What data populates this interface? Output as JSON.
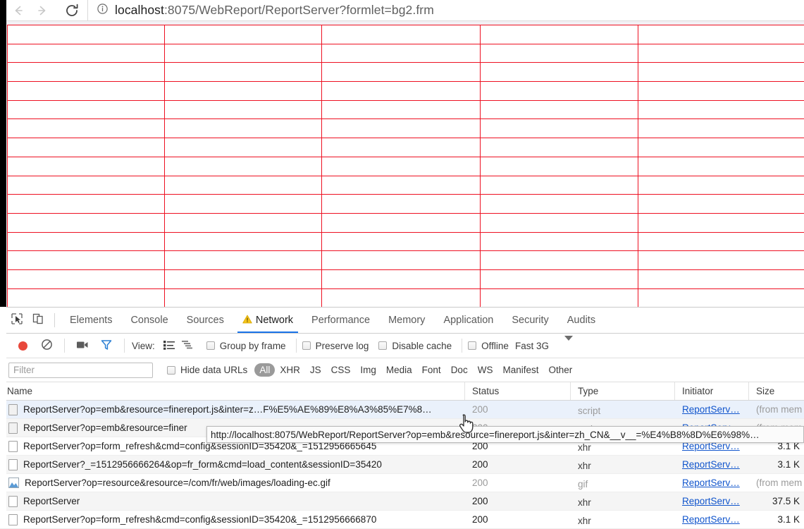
{
  "browser": {
    "back_icon": "arrow-left-icon",
    "forward_icon": "arrow-right-icon",
    "reload_icon": "reload-icon",
    "info_icon": "page-info-icon",
    "url_host": "localhost",
    "url_rest": ":8075/WebReport/ReportServer?formlet=bg2.frm",
    "url_full": "localhost:8075/WebReport/ReportServer?formlet=bg2.frm"
  },
  "report": {
    "grid_border_color": "#ee1122",
    "columns": 6,
    "rows": 16,
    "cells": []
  },
  "devtools": {
    "tools": {
      "inspect_icon": "inspect-element-icon",
      "device_icon": "device-toolbar-icon"
    },
    "tabs": [
      {
        "label": "Elements",
        "active": false,
        "warn": false
      },
      {
        "label": "Console",
        "active": false,
        "warn": false
      },
      {
        "label": "Sources",
        "active": false,
        "warn": false
      },
      {
        "label": "Network",
        "active": true,
        "warn": true
      },
      {
        "label": "Performance",
        "active": false,
        "warn": false
      },
      {
        "label": "Memory",
        "active": false,
        "warn": false
      },
      {
        "label": "Application",
        "active": false,
        "warn": false
      },
      {
        "label": "Security",
        "active": false,
        "warn": false
      },
      {
        "label": "Audits",
        "active": false,
        "warn": false
      }
    ],
    "record_bar": {
      "record_icon": "record-stop-icon",
      "clear_icon": "clear-network-log-icon",
      "capture_screenshots_icon": "camera-icon",
      "filter_icon": "funnel-filter-icon",
      "view_label": "View:",
      "view_list_icon": "list-view-icon",
      "view_waterfall_icon": "waterfall-view-icon",
      "group_by_frame": {
        "label": "Group by frame",
        "checked": false
      },
      "preserve_log": {
        "label": "Preserve log",
        "checked": false
      },
      "disable_cache": {
        "label": "Disable cache",
        "checked": false
      },
      "offline": {
        "label": "Offline",
        "checked": false
      },
      "throttle": {
        "label": "Fast 3G",
        "caret_icon": "chevron-down-icon"
      }
    },
    "filter_bar": {
      "filter_placeholder": "Filter",
      "filter_value": "",
      "hide_data_urls": {
        "label": "Hide data URLs",
        "checked": false
      },
      "types": [
        {
          "label": "All",
          "selected": true
        },
        {
          "label": "XHR",
          "selected": false
        },
        {
          "label": "JS",
          "selected": false
        },
        {
          "label": "CSS",
          "selected": false
        },
        {
          "label": "Img",
          "selected": false
        },
        {
          "label": "Media",
          "selected": false
        },
        {
          "label": "Font",
          "selected": false
        },
        {
          "label": "Doc",
          "selected": false
        },
        {
          "label": "WS",
          "selected": false
        },
        {
          "label": "Manifest",
          "selected": false
        },
        {
          "label": "Other",
          "selected": false
        }
      ]
    },
    "table": {
      "headers": [
        "Name",
        "Status",
        "Type",
        "Initiator",
        "Size"
      ],
      "rows": [
        {
          "icon": "document-icon",
          "name": "ReportServer?op=emb&resource=finereport.js&inter=z…F%E5%AE%89%E8%A3%85%E7%8…",
          "status": "200",
          "type": "script",
          "initiator": "ReportServ…",
          "size": "(from mem",
          "dim": true,
          "hover": true
        },
        {
          "icon": "document-icon",
          "name": "ReportServer?op=emb&resource=finer",
          "status": "200",
          "type": "script",
          "initiator": "ReportServ…",
          "size": "(from mem",
          "dim": true,
          "hover": false
        },
        {
          "icon": "document-icon",
          "name": "ReportServer?op=form_refresh&cmd=config&sessionID=35420&_=1512956665645",
          "status": "200",
          "type": "xhr",
          "initiator": "ReportServ…",
          "size": "3.1 K",
          "dim": false,
          "hover": false
        },
        {
          "icon": "document-icon",
          "name": "ReportServer?_=1512956666264&op=fr_form&cmd=load_content&sessionID=35420",
          "status": "200",
          "type": "xhr",
          "initiator": "ReportServ…",
          "size": "3.1 K",
          "dim": false,
          "hover": false
        },
        {
          "icon": "image-icon",
          "name": "ReportServer?op=resource&resource=/com/fr/web/images/loading-ec.gif",
          "status": "200",
          "type": "gif",
          "initiator": "ReportServ…",
          "size": "(from mem",
          "dim": true,
          "hover": false
        },
        {
          "icon": "document-icon",
          "name": "ReportServer",
          "status": "200",
          "type": "xhr",
          "initiator": "ReportServ…",
          "size": "37.5 K",
          "dim": false,
          "hover": false
        },
        {
          "icon": "document-icon",
          "name": "ReportServer?op=form_refresh&cmd=config&sessionID=35420&_=1512956666870",
          "status": "200",
          "type": "xhr",
          "initiator": "ReportServ…",
          "size": "3.1 K",
          "dim": false,
          "hover": false
        }
      ]
    },
    "tooltip": {
      "text": "http://localhost:8075/WebReport/ReportServer?op=emb&resource=finereport.js&inter=zh_CN&__v__=%E4%B8%8D%E6%98%…"
    },
    "cursor_icon": "pointer-hand-cursor"
  },
  "colors": {
    "accent": "#1a73e8",
    "record": "#e8483b",
    "grid_red": "#ee1122",
    "link": "#1155cc"
  }
}
